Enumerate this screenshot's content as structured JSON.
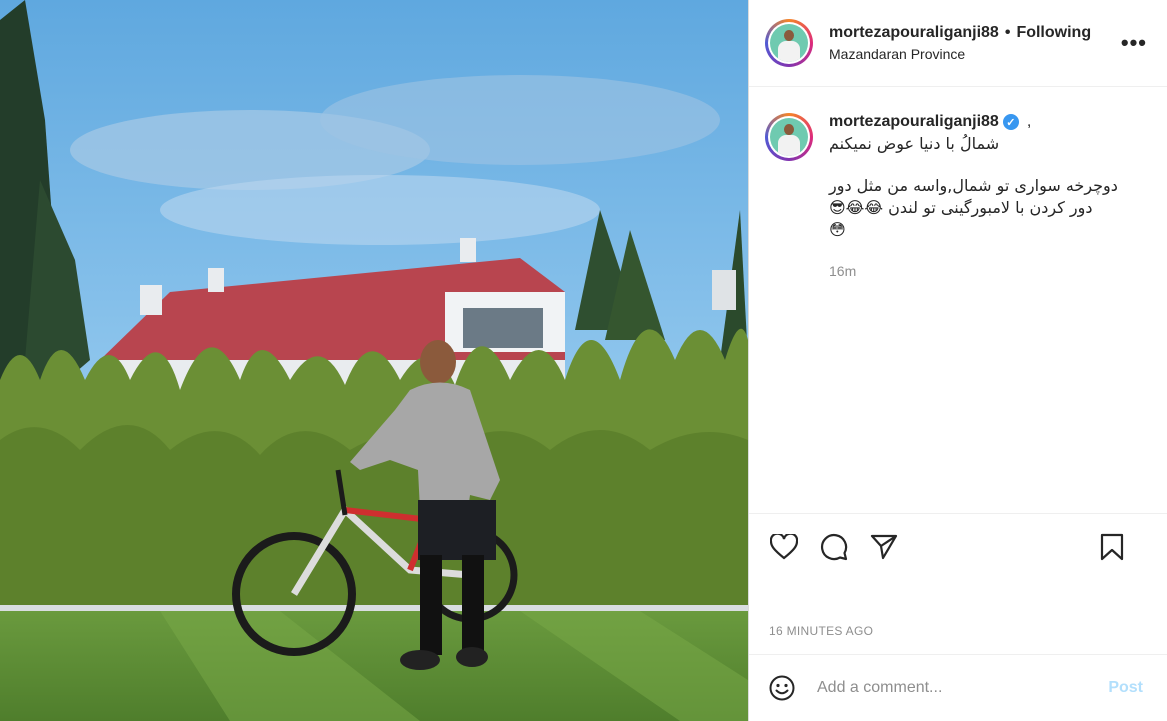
{
  "post": {
    "username": "mortezapouraliganji88",
    "follow_status": "Following",
    "location": "Mazandaran Province"
  },
  "caption": {
    "username": "mortezapouraliganji88",
    "separator": ",",
    "line1": "شمالُ با دنیا عوض نمیکنم",
    "line2": "دوچرخه سواری تو شمال,واسه من مثل دور",
    "line3": "دور کردن با لامبورگینی تو لندن 😂😂😎",
    "line4": "😳",
    "time": "16m"
  },
  "footer": {
    "timestamp": "16 MINUTES AGO",
    "comment_placeholder": "Add a comment...",
    "post_label": "Post"
  },
  "icons": {
    "more": "more-options-icon",
    "like": "heart-icon",
    "comment": "comment-icon",
    "share": "share-icon",
    "save": "bookmark-icon",
    "emoji": "emoji-icon",
    "verified": "verified-badge-icon"
  },
  "colors": {
    "verified": "#3897f0",
    "post_button": "#b2dffc",
    "muted_text": "#8e8e8e"
  }
}
